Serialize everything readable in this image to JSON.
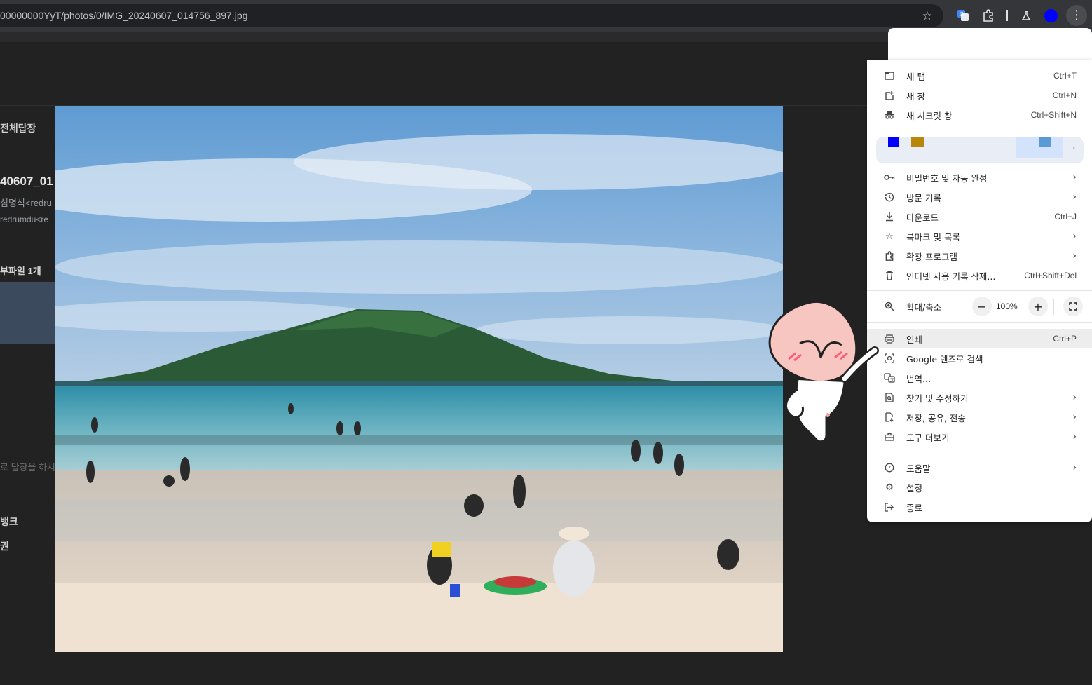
{
  "address_bar": {
    "url": "00000000YyT/photos/0/IMG_20240607_014756_897.jpg"
  },
  "toolbar": {
    "icons": [
      "bookmark-star-icon",
      "google-translate-icon",
      "extensions-icon",
      "labs-flask-icon",
      "profile-avatar",
      "more-menu-icon"
    ],
    "profile_color": "#0000ff"
  },
  "background_page": {
    "reply_all": "전체답장",
    "filename_partial": "40607_01",
    "sender_partial": "심명식<redru",
    "receiver_partial": "redrumdu<re",
    "attachment_partial": "부파일 1개",
    "placeholder_partial": "로 답장을 하시",
    "bank_partial": "뱅크",
    "coupon_partial": "권"
  },
  "chrome_menu": {
    "new_tab": {
      "label": "새 탭",
      "shortcut": "Ctrl+T"
    },
    "new_window": {
      "label": "새 창",
      "shortcut": "Ctrl+N"
    },
    "incognito": {
      "label": "새 시크릿 창",
      "shortcut": "Ctrl+Shift+N"
    },
    "passwords": {
      "label": "비밀번호 및 자동 완성"
    },
    "history": {
      "label": "방문 기록"
    },
    "downloads": {
      "label": "다운로드",
      "shortcut": "Ctrl+J"
    },
    "bookmarks": {
      "label": "북마크 및 목록"
    },
    "extensions": {
      "label": "확장 프로그램"
    },
    "clear_data": {
      "label": "인터넷 사용 기록 삭제...",
      "shortcut": "Ctrl+Shift+Del"
    },
    "zoom": {
      "label": "확대/축소",
      "value": "100%"
    },
    "print": {
      "label": "인쇄",
      "shortcut": "Ctrl+P"
    },
    "lens": {
      "label": "Google 렌즈로 검색"
    },
    "translate": {
      "label": "번역..."
    },
    "find_edit": {
      "label": "찾기 및 수정하기"
    },
    "save_share": {
      "label": "저장, 공유, 전송"
    },
    "more_tools": {
      "label": "도구 더보기"
    },
    "help": {
      "label": "도움말"
    },
    "settings": {
      "label": "설정"
    },
    "exit": {
      "label": "종료"
    },
    "profile_swatches": [
      "#0000ff",
      "#b8860b",
      "#5b9bd5"
    ]
  }
}
